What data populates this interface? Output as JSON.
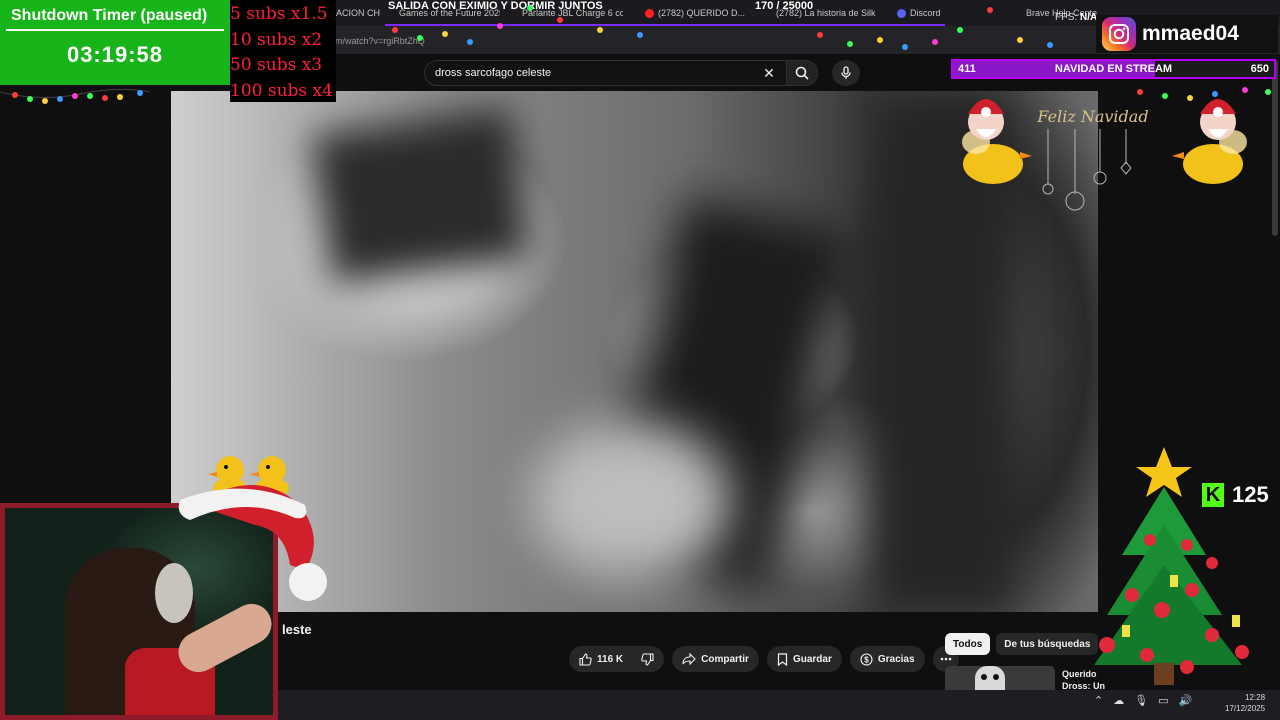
{
  "browser": {
    "tabs": [
      {
        "label": "ACION CH",
        "color": "#888888"
      },
      {
        "label": "Games of the Future 2025",
        "color": "#ff4444"
      },
      {
        "label": "Parlante JBL Charge 6 col...",
        "color": "#cc4444"
      },
      {
        "label": "(2782) QUERIDO D...",
        "color": "#ff2222"
      },
      {
        "label": "(2782) La historia de Silk R...",
        "color": "#ff2222"
      },
      {
        "label": "Discord",
        "color": "#5865f2"
      },
      {
        "label": "Brave Help Cente...",
        "color": "#fb542b"
      }
    ],
    "address": "om/watch?v=rgiRbtZhQ"
  },
  "youtube": {
    "search_query": "dross sarcofago celeste",
    "video_title_visible": "leste",
    "actions": {
      "likes": "116 K",
      "share": "Compartir",
      "save": "Guardar",
      "thanks": "Gracias"
    },
    "chips": [
      "Todos",
      "De tus búsquedas"
    ],
    "recommendation_title": "Querido Dross: Un Payaso"
  },
  "overlay": {
    "timer_title": "Shutdown Timer (paused)",
    "timer_value": "03:19:58",
    "subs_multipliers": [
      "5 subs x1.5",
      "10 subs x2",
      "50 subs x3",
      "100 subs x4"
    ],
    "top_banner": "SALIDA CON EXIMIO Y DORMIR JUNTOS",
    "goal_counter": "170 / 25000",
    "fps_label": "FPS:",
    "fps_value": "N/A",
    "instagram_handle": "mmaed04",
    "stream_goal": {
      "left": "411",
      "title": "NAVIDAD EN STREAM",
      "right": "650",
      "progress": 0.63
    },
    "kick_viewers": "125",
    "greeting": "Feliz Navidad"
  },
  "taskbar": {
    "time": "12:28",
    "date": "17/12/2025"
  },
  "colors": {
    "timer_green": "#18b51a",
    "subs_red": "#ff1f3a",
    "goal_purple": "#b400ff",
    "kick_green": "#53fc18",
    "webcam_border": "#8e1b2a"
  }
}
